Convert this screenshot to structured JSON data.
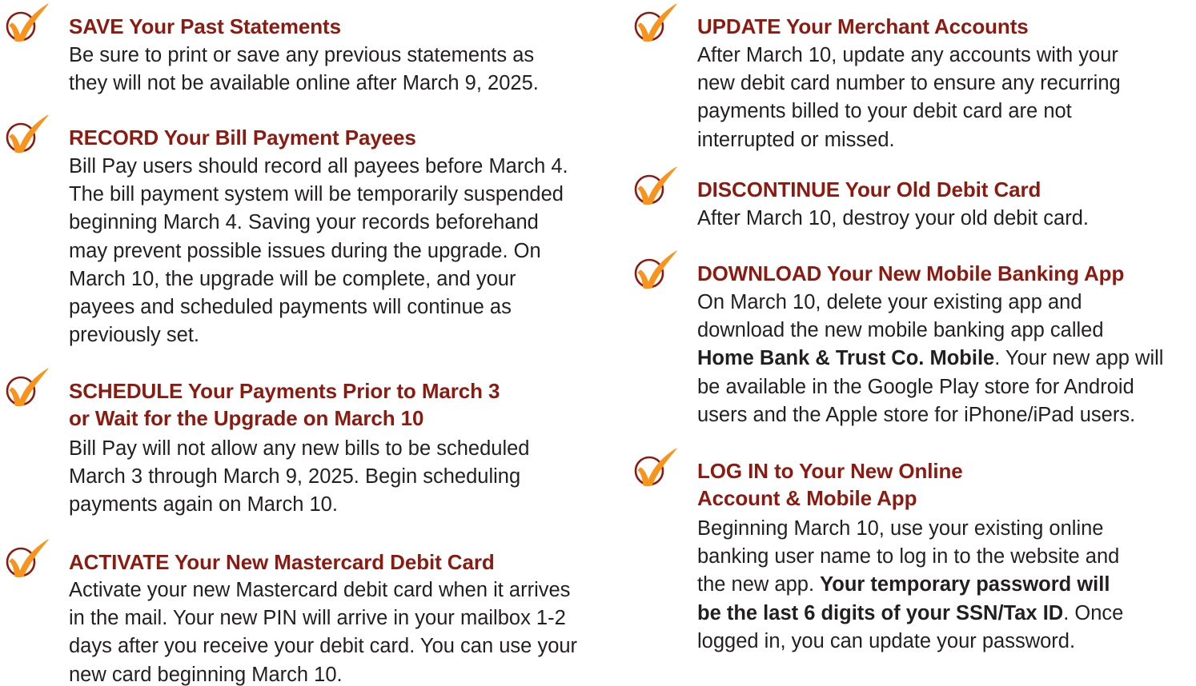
{
  "brand": {
    "accent_color": "#8b1a10",
    "check_color": "#f7941d",
    "text_color": "#231f20",
    "icon": "checkmark-circle-icon"
  },
  "left_column": {
    "items": [
      {
        "title": "SAVE Your Past Statements",
        "lines": [
          "Be sure to print or save any previous statements as",
          "they will not be available online after March 9, 2025."
        ]
      },
      {
        "title": "RECORD Your Bill Payment Payees",
        "lines": [
          "Bill Pay users should record all payees before March 4.",
          "The bill payment system will be temporarily suspended",
          "beginning March 4. Saving your records beforehand",
          "may prevent possible issues during the upgrade. On",
          "March 10, the upgrade will be complete, and your",
          "payees and scheduled payments will continue as",
          "previously set."
        ]
      },
      {
        "title_lines": [
          "SCHEDULE Your Payments Prior to March 3",
          "or Wait for the Upgrade on March 10"
        ],
        "lines": [
          "Bill Pay will not allow any new bills to be scheduled",
          "March 3 through March 9, 2025. Begin scheduling",
          "payments again on March 10."
        ]
      },
      {
        "title": "ACTIVATE Your New Mastercard Debit Card",
        "lines": [
          "Activate your new Mastercard debit card when it arrives",
          "in the mail. Your new PIN will arrive in your mailbox 1-2",
          "days after you receive your debit card. You can use your",
          "new card beginning March 10."
        ]
      }
    ]
  },
  "right_column": {
    "items": [
      {
        "title": "UPDATE Your Merchant Accounts",
        "lines": [
          "After March 10, update any accounts with your",
          "new debit card number to ensure any recurring",
          "payments billed to your debit card are not",
          "interrupted or missed."
        ]
      },
      {
        "title": "DISCONTINUE Your Old Debit Card",
        "lines": [
          "After March 10, destroy your old debit card."
        ]
      },
      {
        "title": "DOWNLOAD Your New Mobile Banking App",
        "line1": "On March 10, delete your existing app and",
        "line2": "download the new mobile banking app called",
        "line3_bold": "Home Bank & Trust Co. Mobile",
        "line3_rest": ". Your new app will",
        "line4": "be available in the Google Play store for Android",
        "line5": "users and the Apple store for iPhone/iPad users."
      },
      {
        "title_lines": [
          "LOG IN to Your New Online",
          "Account & Mobile App"
        ],
        "line1": "Beginning March 10, use your existing online",
        "line2": "banking user name to log in to the website and",
        "line3_plain": "the new app. ",
        "line3_bold": "Your temporary password will",
        "line4_bold": "be the last 6 digits of your SSN/Tax ID",
        "line4_rest": ". Once",
        "line5": "logged in, you can update your password."
      }
    ]
  }
}
